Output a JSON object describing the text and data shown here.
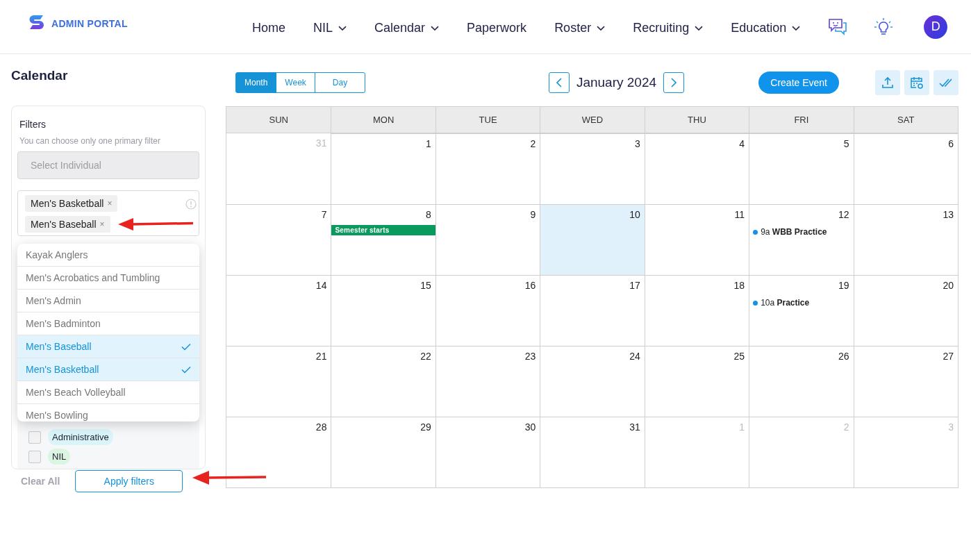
{
  "brand": {
    "name": "ADMIN PORTAL"
  },
  "nav": [
    {
      "label": "Home",
      "dropdown": false
    },
    {
      "label": "NIL",
      "dropdown": true
    },
    {
      "label": "Calendar",
      "dropdown": true
    },
    {
      "label": "Paperwork",
      "dropdown": false
    },
    {
      "label": "Roster",
      "dropdown": true
    },
    {
      "label": "Recruiting",
      "dropdown": true
    },
    {
      "label": "Education",
      "dropdown": true
    }
  ],
  "avatar": {
    "initial": "D"
  },
  "page_title": "Calendar",
  "filters": {
    "title": "Filters",
    "hint": "You can choose only one primary filter",
    "individual": {
      "placeholder": "Select Individual"
    },
    "tags": [
      {
        "label": "Men's Basketball",
        "remove": "×"
      },
      {
        "label": "Men's Baseball",
        "remove": "×"
      }
    ],
    "options": [
      {
        "label": "Kayak Anglers",
        "selected": false
      },
      {
        "label": "Men's Acrobatics and Tumbling",
        "selected": false
      },
      {
        "label": "Men's Admin",
        "selected": false
      },
      {
        "label": "Men's Badminton",
        "selected": false
      },
      {
        "label": "Men's Baseball",
        "selected": true
      },
      {
        "label": "Men's Basketball",
        "selected": true
      },
      {
        "label": "Men's Beach Volleyball",
        "selected": false
      },
      {
        "label": "Men's Bowling",
        "selected": false
      }
    ],
    "categories": [
      {
        "label": "Administrative",
        "checked": false,
        "color": "#daf5fa"
      },
      {
        "label": "NIL",
        "checked": false,
        "color": "#dcf5e3"
      }
    ],
    "clear": "Clear All",
    "apply": "Apply filters"
  },
  "view_modes": [
    {
      "label": "Month",
      "selected": true
    },
    {
      "label": "Week",
      "selected": false
    },
    {
      "label": "Day",
      "selected": false
    }
  ],
  "month_label": "January 2024",
  "create_button": "Create Event",
  "calendar": {
    "weekdays": [
      "SUN",
      "MON",
      "TUE",
      "WED",
      "THU",
      "FRI",
      "SAT"
    ],
    "weeks": [
      [
        {
          "day": "31",
          "muted": true,
          "selected": false
        },
        {
          "day": "1",
          "muted": false,
          "selected": false
        },
        {
          "day": "2",
          "muted": false,
          "selected": false
        },
        {
          "day": "3",
          "muted": false,
          "selected": false
        },
        {
          "day": "4",
          "muted": false,
          "selected": false
        },
        {
          "day": "5",
          "muted": false,
          "selected": false
        },
        {
          "day": "6",
          "muted": false,
          "selected": false
        }
      ],
      [
        {
          "day": "7",
          "muted": false,
          "selected": false
        },
        {
          "day": "8",
          "muted": false,
          "selected": false,
          "events": [
            {
              "kind": "bar",
              "title": "Semester starts",
              "color": "#0b9a5e"
            }
          ]
        },
        {
          "day": "9",
          "muted": false,
          "selected": false
        },
        {
          "day": "10",
          "muted": false,
          "selected": true
        },
        {
          "day": "11",
          "muted": false,
          "selected": false
        },
        {
          "day": "12",
          "muted": false,
          "selected": false,
          "events": [
            {
              "kind": "dot",
              "time": "9a",
              "title": "WBB Practice",
              "color": "#1592e6"
            }
          ]
        },
        {
          "day": "13",
          "muted": false,
          "selected": false
        }
      ],
      [
        {
          "day": "14",
          "muted": false,
          "selected": false
        },
        {
          "day": "15",
          "muted": false,
          "selected": false
        },
        {
          "day": "16",
          "muted": false,
          "selected": false
        },
        {
          "day": "17",
          "muted": false,
          "selected": false
        },
        {
          "day": "18",
          "muted": false,
          "selected": false
        },
        {
          "day": "19",
          "muted": false,
          "selected": false,
          "events": [
            {
              "kind": "dot",
              "time": "10a",
              "title": "Practice",
              "color": "#1592e6"
            }
          ]
        },
        {
          "day": "20",
          "muted": false,
          "selected": false
        }
      ],
      [
        {
          "day": "21",
          "muted": false,
          "selected": false
        },
        {
          "day": "22",
          "muted": false,
          "selected": false
        },
        {
          "day": "23",
          "muted": false,
          "selected": false
        },
        {
          "day": "24",
          "muted": false,
          "selected": false
        },
        {
          "day": "25",
          "muted": false,
          "selected": false
        },
        {
          "day": "26",
          "muted": false,
          "selected": false
        },
        {
          "day": "27",
          "muted": false,
          "selected": false
        }
      ],
      [
        {
          "day": "28",
          "muted": false,
          "selected": false
        },
        {
          "day": "29",
          "muted": false,
          "selected": false
        },
        {
          "day": "30",
          "muted": false,
          "selected": false
        },
        {
          "day": "31",
          "muted": false,
          "selected": false
        },
        {
          "day": "1",
          "muted": true,
          "selected": false
        },
        {
          "day": "2",
          "muted": true,
          "selected": false
        },
        {
          "day": "3",
          "muted": true,
          "selected": false
        }
      ]
    ]
  }
}
